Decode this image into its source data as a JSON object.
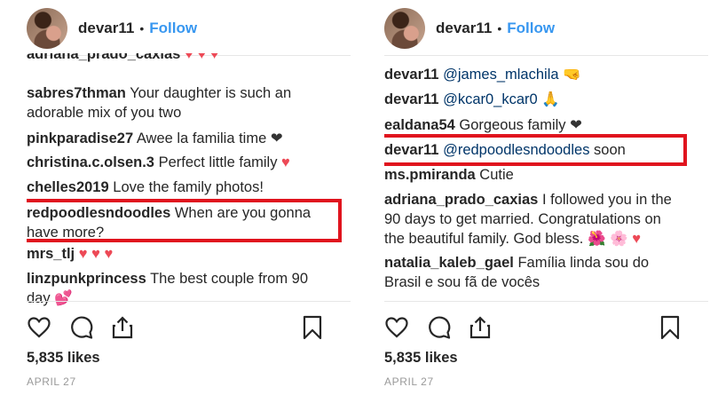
{
  "left": {
    "username": "devar11",
    "separator": "•",
    "follow_label": "Follow",
    "clipped_comment": {
      "user": "adriana_prado_caxias",
      "emoji": "♥ ♥ ♥"
    },
    "comments": [
      {
        "user": "sabres7thman",
        "text": "Your daughter is such an",
        "text2": "adorable mix of you two"
      },
      {
        "user": "pinkparadise27",
        "text": "Awee la familia time",
        "emoji": "❤"
      },
      {
        "user": "christina.c.olsen.3",
        "text": "Perfect little family",
        "emoji": "♥"
      },
      {
        "user": "chelles2019",
        "text": "Love the family photos!"
      },
      {
        "user": "redpoodlesndoodles",
        "text": "When are you gonna",
        "text2": "have more?"
      },
      {
        "user": "mrs_tlj",
        "emoji": "♥ ♥ ♥"
      },
      {
        "user": "linzpunkprincess",
        "text": "The best couple from 90",
        "text2": "day",
        "emoji2": "💕"
      }
    ],
    "likes": "5,835 likes",
    "date": "APRIL 27"
  },
  "right": {
    "username": "devar11",
    "separator": "•",
    "follow_label": "Follow",
    "comments": [
      {
        "user": "devar11",
        "mention": "@james_mlachila",
        "emoji": "🤜"
      },
      {
        "user": "devar11",
        "mention": "@kcar0_kcar0",
        "emoji": "🙏"
      },
      {
        "user": "ealdana54",
        "text": "Gorgeous family",
        "emoji": "❤"
      },
      {
        "user": "devar11",
        "mention": "@redpoodlesndoodles",
        "text": "soon"
      },
      {
        "user": "ms.pmiranda",
        "text": "Cutie"
      },
      {
        "user": "adriana_prado_caxias",
        "text": "I followed you in the",
        "text2": "90 days to get married. Congratulations on",
        "text3": "the beautiful family. God bless.",
        "emoji3": "🌺 🌸 ♥"
      },
      {
        "user": "natalia_kaleb_gael",
        "text": "Família linda sou do",
        "text2": "Brasil e sou fã de vocês"
      }
    ],
    "likes": "5,835 likes",
    "date": "APRIL 27"
  },
  "colors": {
    "follow": "#3897f0",
    "highlight": "#e0141e",
    "heart": "#ed4956",
    "mention": "#003569",
    "meta": "#999999"
  },
  "icons": [
    "heart-outline-icon",
    "comment-bubble-icon",
    "share-icon",
    "bookmark-icon"
  ]
}
